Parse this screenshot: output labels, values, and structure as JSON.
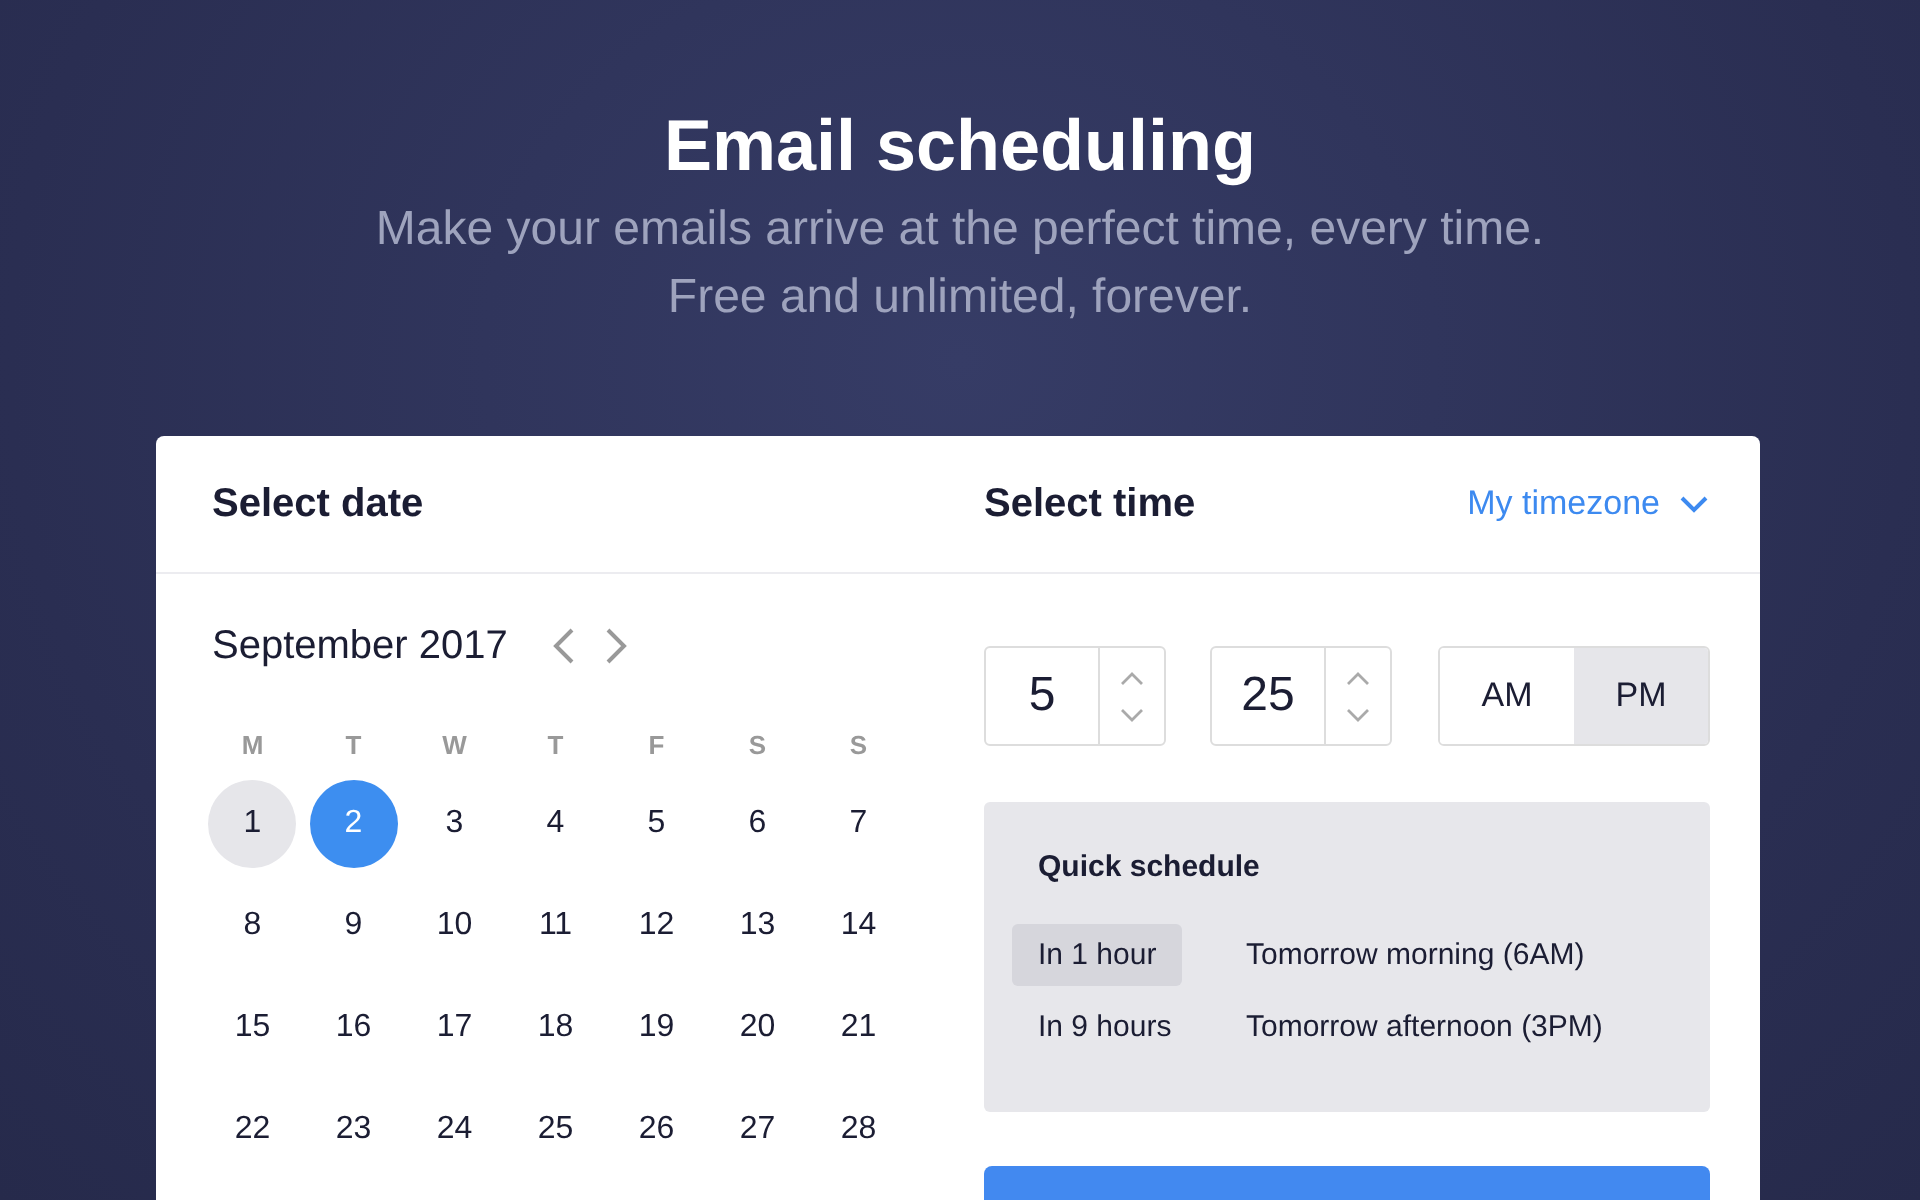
{
  "hero": {
    "title": "Email scheduling",
    "subtitle_lines": [
      "Make your emails arrive at the perfect time, every time.",
      "Free and unlimited, forever."
    ]
  },
  "date_panel": {
    "title": "Select date",
    "month": "September 2017",
    "weekdays": [
      "M",
      "T",
      "W",
      "T",
      "F",
      "S",
      "S"
    ],
    "days": [
      {
        "label": "1",
        "selected": false,
        "today": true
      },
      {
        "label": "2",
        "selected": true,
        "today": false
      },
      {
        "label": "3",
        "selected": false,
        "today": false
      },
      {
        "label": "4",
        "selected": false,
        "today": false
      },
      {
        "label": "5",
        "selected": false,
        "today": false
      },
      {
        "label": "6",
        "selected": false,
        "today": false
      },
      {
        "label": "7",
        "selected": false,
        "today": false
      },
      {
        "label": "8",
        "selected": false,
        "today": false
      },
      {
        "label": "9",
        "selected": false,
        "today": false
      },
      {
        "label": "10",
        "selected": false,
        "today": false
      },
      {
        "label": "11",
        "selected": false,
        "today": false
      },
      {
        "label": "12",
        "selected": false,
        "today": false
      },
      {
        "label": "13",
        "selected": false,
        "today": false
      },
      {
        "label": "14",
        "selected": false,
        "today": false
      },
      {
        "label": "15",
        "selected": false,
        "today": false
      },
      {
        "label": "16",
        "selected": false,
        "today": false
      },
      {
        "label": "17",
        "selected": false,
        "today": false
      },
      {
        "label": "18",
        "selected": false,
        "today": false
      },
      {
        "label": "19",
        "selected": false,
        "today": false
      },
      {
        "label": "20",
        "selected": false,
        "today": false
      },
      {
        "label": "21",
        "selected": false,
        "today": false
      },
      {
        "label": "22",
        "selected": false,
        "today": false
      },
      {
        "label": "23",
        "selected": false,
        "today": false
      },
      {
        "label": "24",
        "selected": false,
        "today": false
      },
      {
        "label": "25",
        "selected": false,
        "today": false
      },
      {
        "label": "26",
        "selected": false,
        "today": false
      },
      {
        "label": "27",
        "selected": false,
        "today": false
      },
      {
        "label": "28",
        "selected": false,
        "today": false
      }
    ]
  },
  "time_panel": {
    "title": "Select time",
    "timezone": "My timezone",
    "hour": "5",
    "minute": "25",
    "meridiem": [
      {
        "label": "AM",
        "selected": false
      },
      {
        "label": "PM",
        "selected": true
      }
    ],
    "quick_schedule": {
      "title": "Quick schedule",
      "options": [
        {
          "label": "In 1 hour",
          "selected": true
        },
        {
          "label": "Tomorrow morning (6AM)",
          "selected": false
        },
        {
          "label": "In 9 hours",
          "selected": false
        },
        {
          "label": "Tomorrow afternoon (3PM)",
          "selected": false
        }
      ]
    }
  }
}
